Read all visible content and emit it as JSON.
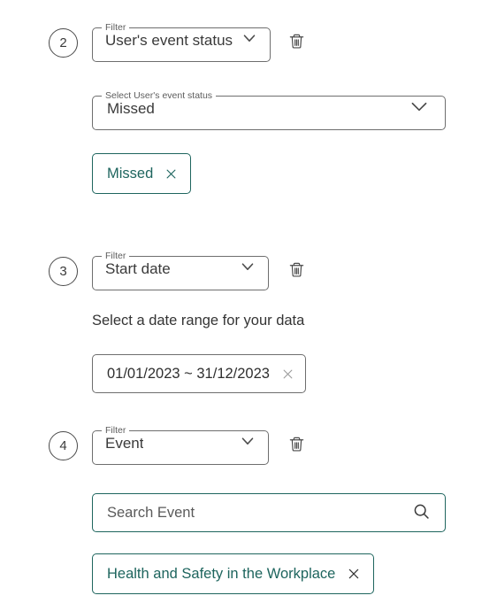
{
  "colors": {
    "accent_teal": "#1e655e",
    "border_gray": "#6e6e6e",
    "text_dark": "#3a3a3a",
    "label_gray": "#5d5d5d",
    "background": "#ffffff"
  },
  "groups": [
    {
      "step": "2",
      "filter": {
        "legend": "Filter",
        "value": "User's event status",
        "chevron_icon": "chevron-down-icon"
      },
      "delete_icon": "trash-icon",
      "control": {
        "kind": "select",
        "legend": "Select User's event status",
        "value": "Missed",
        "chevron_icon": "chevron-down-icon"
      },
      "chips": [
        {
          "label": "Missed",
          "remove_icon": "close-icon"
        }
      ]
    },
    {
      "step": "3",
      "filter": {
        "legend": "Filter",
        "value": "Start date",
        "chevron_icon": "chevron-down-icon"
      },
      "delete_icon": "trash-icon",
      "control": {
        "kind": "date-range",
        "label": "Select a date range for your data",
        "value": "01/01/2023 ~ 31/12/2023",
        "clear_icon": "close-icon"
      },
      "chips": []
    },
    {
      "step": "4",
      "filter": {
        "legend": "Filter",
        "value": "Event",
        "chevron_icon": "chevron-down-icon"
      },
      "delete_icon": "trash-icon",
      "control": {
        "kind": "search",
        "placeholder": "Search Event",
        "value": "",
        "search_icon": "search-icon"
      },
      "chips": [
        {
          "label": "Health and Safety in the Workplace",
          "remove_icon": "close-icon"
        }
      ]
    }
  ]
}
